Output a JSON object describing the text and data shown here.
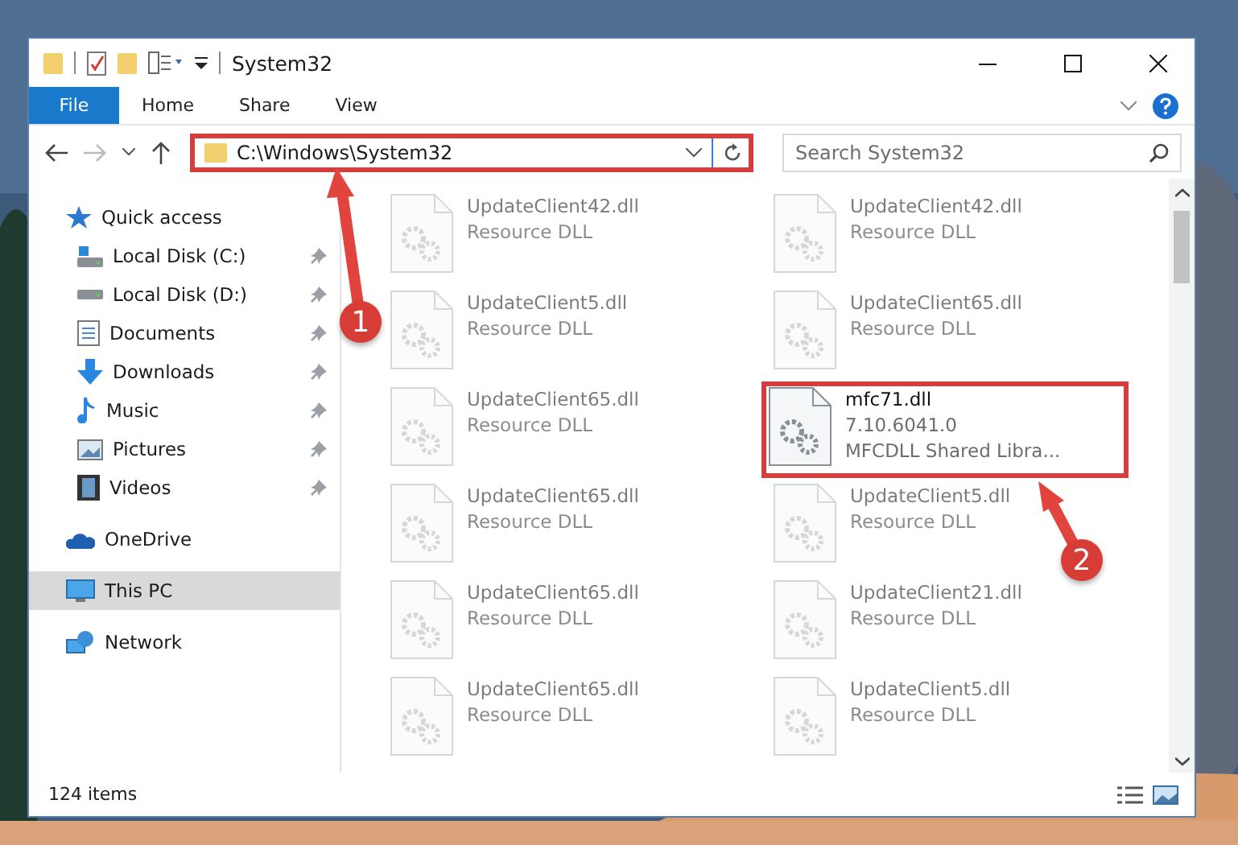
{
  "window": {
    "title": "System32"
  },
  "ribbon_tabs": [
    {
      "label": "File",
      "selected": true
    },
    {
      "label": "Home",
      "selected": false
    },
    {
      "label": "Share",
      "selected": false
    },
    {
      "label": "View",
      "selected": false
    }
  ],
  "address": {
    "value": "C:\\Windows\\System32",
    "outlined": true
  },
  "search": {
    "placeholder": "Search System32"
  },
  "sidebar": {
    "items": [
      {
        "label": "Quick access",
        "kind": "quick",
        "pinned": false,
        "selected": false,
        "children": [
          {
            "label": "Local Disk (C:)",
            "kind": "diskc",
            "pinned": true,
            "selected": false
          },
          {
            "label": "Local Disk (D:)",
            "kind": "disk",
            "pinned": true,
            "selected": false
          },
          {
            "label": "Documents",
            "kind": "documents",
            "pinned": true,
            "selected": false
          },
          {
            "label": "Downloads",
            "kind": "downloads",
            "pinned": true,
            "selected": false
          },
          {
            "label": "Music",
            "kind": "music",
            "pinned": true,
            "selected": false
          },
          {
            "label": "Pictures",
            "kind": "pictures",
            "pinned": true,
            "selected": false
          },
          {
            "label": "Videos",
            "kind": "videos",
            "pinned": true,
            "selected": false
          }
        ]
      },
      {
        "label": "OneDrive",
        "kind": "onedrive",
        "pinned": false,
        "selected": false
      },
      {
        "label": "This PC",
        "kind": "pc",
        "pinned": false,
        "selected": true
      },
      {
        "label": "Network",
        "kind": "network",
        "pinned": false,
        "selected": false
      }
    ]
  },
  "files": [
    {
      "name": "UpdateClient42.dll",
      "lines": [
        "Resource DLL"
      ],
      "faded": true,
      "outlined": false
    },
    {
      "name": "UpdateClient42.dll",
      "lines": [
        "Resource DLL"
      ],
      "faded": true,
      "outlined": false
    },
    {
      "name": "UpdateClient5.dll",
      "lines": [
        "Resource DLL"
      ],
      "faded": true,
      "outlined": false
    },
    {
      "name": "UpdateClient65.dll",
      "lines": [
        "Resource DLL"
      ],
      "faded": true,
      "outlined": false
    },
    {
      "name": "UpdateClient65.dll",
      "lines": [
        "Resource DLL"
      ],
      "faded": true,
      "outlined": false
    },
    {
      "name": "mfc71.dll",
      "lines": [
        "7.10.6041.0",
        "MFCDLL Shared Libra..."
      ],
      "faded": false,
      "outlined": true
    },
    {
      "name": "UpdateClient65.dll",
      "lines": [
        "Resource DLL"
      ],
      "faded": true,
      "outlined": false
    },
    {
      "name": "UpdateClient5.dll",
      "lines": [
        "Resource DLL"
      ],
      "faded": true,
      "outlined": false
    },
    {
      "name": "UpdateClient65.dll",
      "lines": [
        "Resource DLL"
      ],
      "faded": true,
      "outlined": false
    },
    {
      "name": "UpdateClient21.dll",
      "lines": [
        "Resource DLL"
      ],
      "faded": true,
      "outlined": false
    },
    {
      "name": "UpdateClient65.dll",
      "lines": [
        "Resource DLL"
      ],
      "faded": true,
      "outlined": false
    },
    {
      "name": "UpdateClient5.dll",
      "lines": [
        "Resource DLL"
      ],
      "faded": true,
      "outlined": false
    }
  ],
  "status_bar": {
    "count": "124 items"
  },
  "callouts": [
    {
      "number": "1"
    },
    {
      "number": "2"
    }
  ]
}
